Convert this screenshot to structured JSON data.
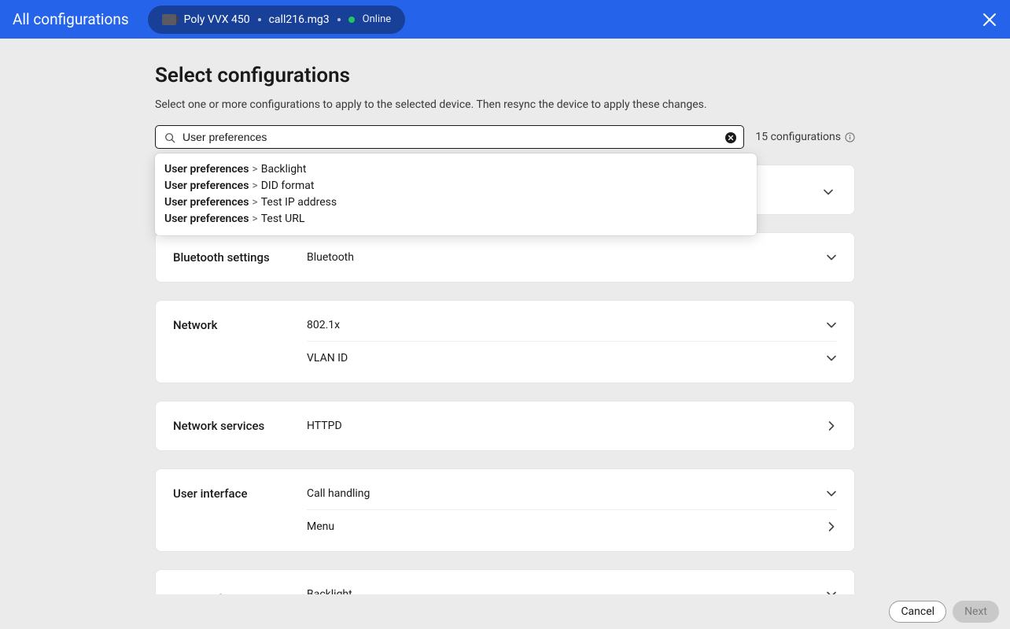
{
  "topbar": {
    "title": "All configurations",
    "device_name": "Poly VVX 450",
    "device_id": "call216.mg3",
    "status_label": "Online"
  },
  "page": {
    "title": "Select configurations",
    "subtitle": "Select one or more configurations to apply to the selected device. Then resync the device to apply these changes."
  },
  "search": {
    "value": "User preferences",
    "count_label": "15 configurations"
  },
  "autocomplete": [
    {
      "prefix": "User preferences",
      "suffix": "Backlight"
    },
    {
      "prefix": "User preferences",
      "suffix": "DID format"
    },
    {
      "prefix": "User preferences",
      "suffix": "Test IP address"
    },
    {
      "prefix": "User preferences",
      "suffix": "Test URL"
    }
  ],
  "sections": [
    {
      "label": "Bluetooth settings",
      "items": [
        {
          "name": "Bluetooth",
          "icon": "chevron-down"
        }
      ]
    },
    {
      "label": "Network",
      "items": [
        {
          "name": "802.1x",
          "icon": "chevron-down"
        },
        {
          "name": "VLAN ID",
          "icon": "chevron-down"
        }
      ]
    },
    {
      "label": "Network services",
      "items": [
        {
          "name": "HTTPD",
          "icon": "chevron-right"
        }
      ]
    },
    {
      "label": "User interface",
      "items": [
        {
          "name": "Call handling",
          "icon": "chevron-down"
        },
        {
          "name": "Menu",
          "icon": "chevron-right"
        }
      ]
    },
    {
      "label": "User preferences",
      "items": [
        {
          "name": "Backlight",
          "icon": "chevron-down"
        }
      ]
    }
  ],
  "footer": {
    "cancel": "Cancel",
    "next": "Next"
  }
}
